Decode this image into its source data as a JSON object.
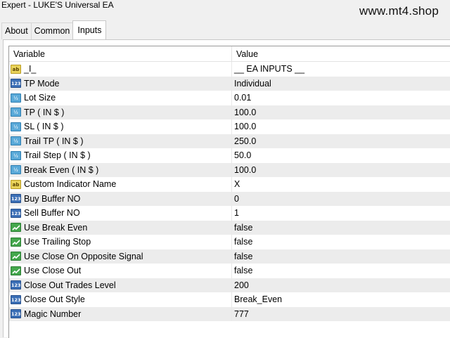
{
  "window": {
    "title": "Expert - LUKE'S Universal EA",
    "watermark": "www.mt4.shop"
  },
  "tabs": [
    {
      "label": "About",
      "active": false
    },
    {
      "label": "Common",
      "active": false
    },
    {
      "label": "Inputs",
      "active": true
    }
  ],
  "grid": {
    "headers": {
      "variable": "Variable",
      "value": "Value"
    },
    "rows": [
      {
        "icon": "ab",
        "variable": "_I_",
        "value": "__ EA INPUTS __"
      },
      {
        "icon": "123",
        "variable": "TP Mode",
        "value": "Individual"
      },
      {
        "icon": "frac",
        "variable": "Lot Size",
        "value": "0.01"
      },
      {
        "icon": "frac",
        "variable": "TP ( IN $ )",
        "value": "100.0"
      },
      {
        "icon": "frac",
        "variable": "SL ( IN $ )",
        "value": "100.0"
      },
      {
        "icon": "frac",
        "variable": "Trail TP ( IN $ )",
        "value": "250.0"
      },
      {
        "icon": "frac",
        "variable": "Trail Step ( IN $ )",
        "value": "50.0"
      },
      {
        "icon": "frac",
        "variable": "Break Even ( IN $ )",
        "value": "100.0"
      },
      {
        "icon": "ab",
        "variable": "Custom Indicator Name",
        "value": "X"
      },
      {
        "icon": "123",
        "variable": "Buy Buffer NO",
        "value": "0"
      },
      {
        "icon": "123",
        "variable": "Sell Buffer NO",
        "value": "1"
      },
      {
        "icon": "bool",
        "variable": "Use Break Even",
        "value": "false"
      },
      {
        "icon": "bool",
        "variable": "Use Trailing Stop",
        "value": "false"
      },
      {
        "icon": "bool",
        "variable": "Use Close On Opposite Signal",
        "value": "false"
      },
      {
        "icon": "bool",
        "variable": "Use Close Out",
        "value": "false"
      },
      {
        "icon": "123",
        "variable": "Close Out Trades Level",
        "value": "200"
      },
      {
        "icon": "123",
        "variable": "Close Out Style",
        "value": "Break_Even"
      },
      {
        "icon": "123",
        "variable": "Magic Number",
        "value": "777"
      }
    ]
  }
}
